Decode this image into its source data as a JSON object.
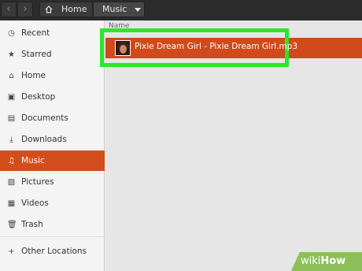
{
  "header": {
    "back_icon": "chevron-left-icon",
    "forward_icon": "chevron-right-icon",
    "breadcrumb": [
      {
        "label": "Home",
        "icon": "home-icon"
      },
      {
        "label": "Music",
        "icon": "chevron-down-icon"
      }
    ]
  },
  "sidebar": {
    "items": [
      {
        "label": "Recent",
        "icon": "clock-icon"
      },
      {
        "label": "Starred",
        "icon": "star-icon"
      },
      {
        "label": "Home",
        "icon": "home-icon"
      },
      {
        "label": "Desktop",
        "icon": "desktop-icon"
      },
      {
        "label": "Documents",
        "icon": "document-icon"
      },
      {
        "label": "Downloads",
        "icon": "download-icon"
      },
      {
        "label": "Music",
        "icon": "music-icon",
        "active": true
      },
      {
        "label": "Pictures",
        "icon": "picture-icon"
      },
      {
        "label": "Videos",
        "icon": "video-icon"
      },
      {
        "label": "Trash",
        "icon": "trash-icon"
      },
      {
        "label": "Other Locations",
        "icon": "plus-icon"
      }
    ]
  },
  "main": {
    "column_header": "Name",
    "files": [
      {
        "name": "Pixie Dream Girl - Pixie Dream Girl.mp3",
        "icon": "album-art-thumbnail",
        "selected": true
      }
    ],
    "highlight_color": "#2de52a",
    "selection_color": "#d04a1c"
  },
  "watermark": {
    "part1": "wiki",
    "part2": "How"
  }
}
